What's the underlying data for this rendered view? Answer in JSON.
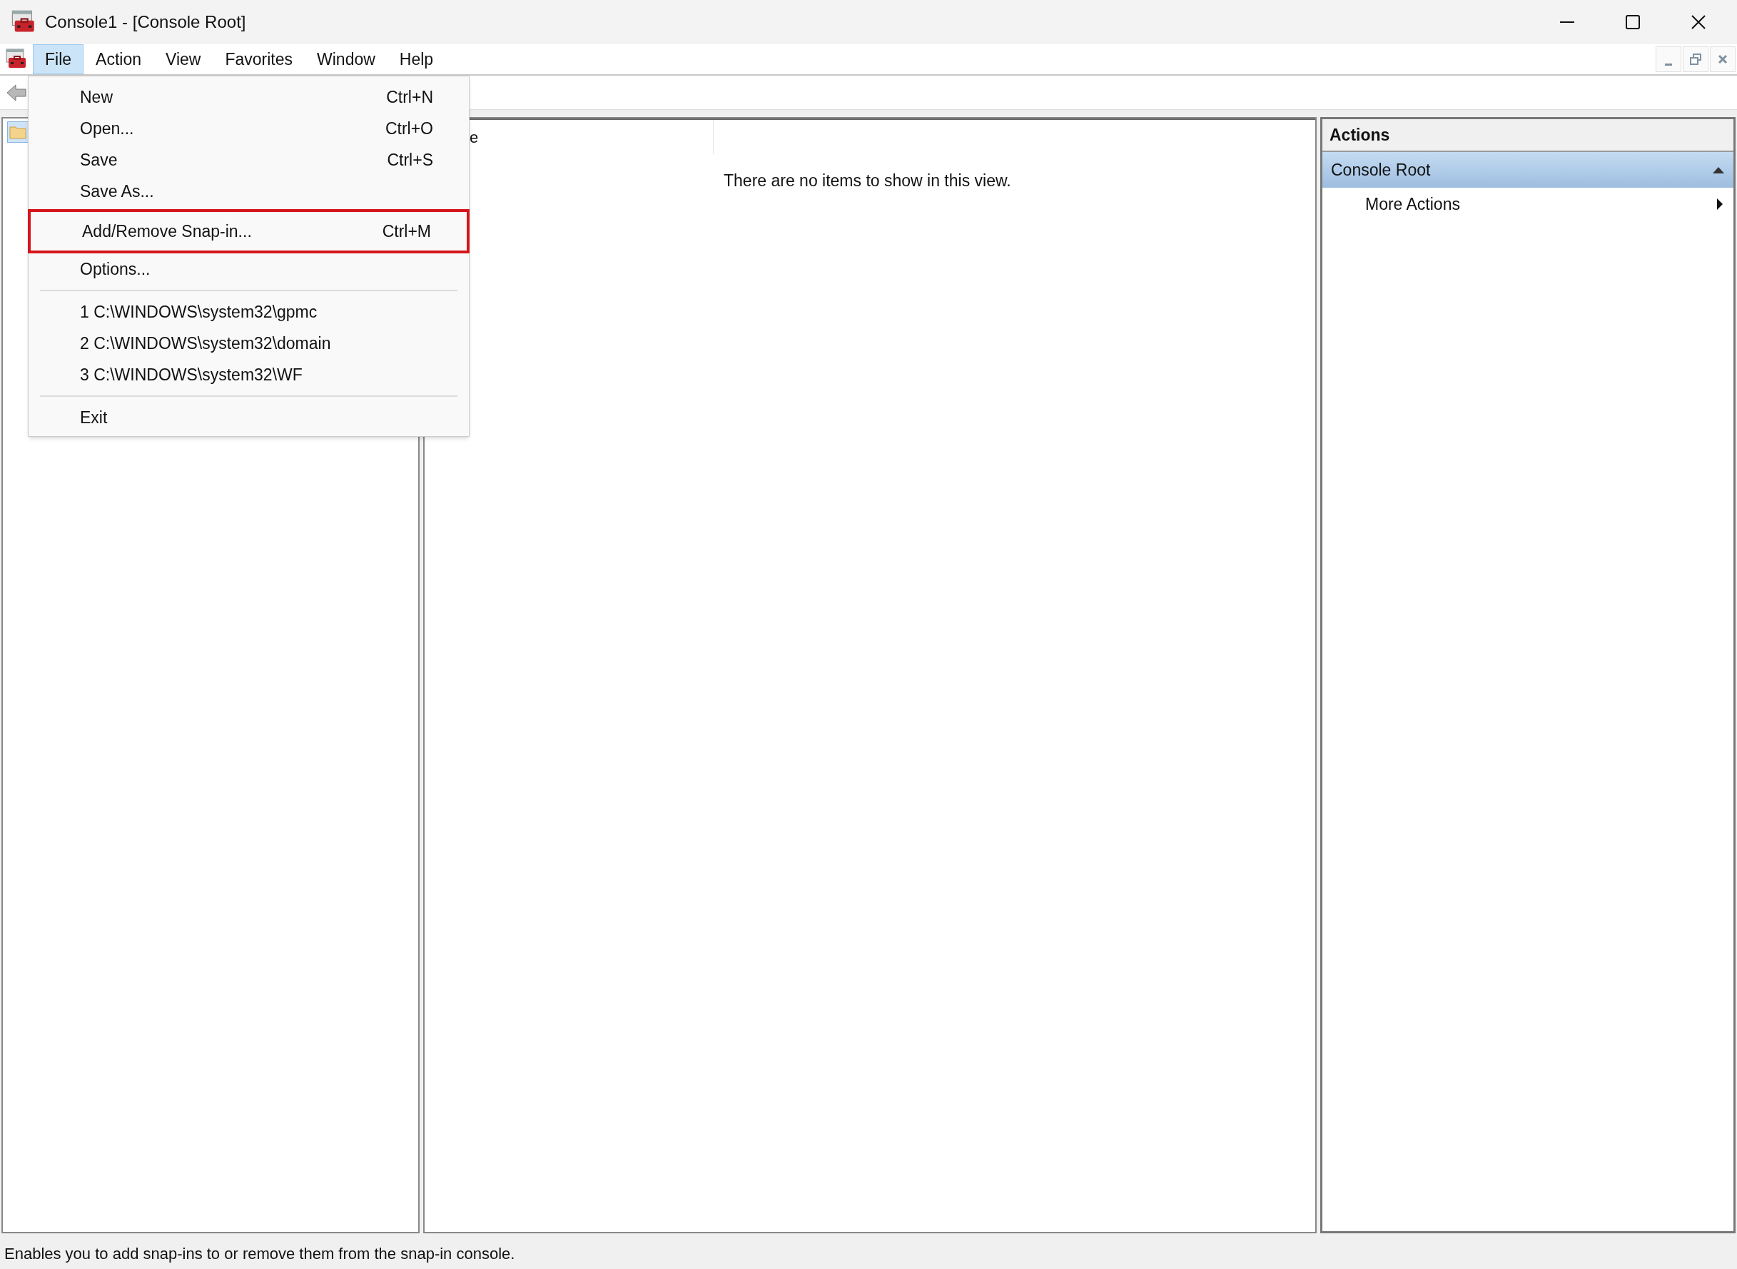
{
  "window": {
    "title": "Console1 - [Console Root]"
  },
  "menu_bar": [
    {
      "label": "File",
      "selected": true
    },
    {
      "label": "Action",
      "selected": false
    },
    {
      "label": "View",
      "selected": false
    },
    {
      "label": "Favorites",
      "selected": false
    },
    {
      "label": "Window",
      "selected": false
    },
    {
      "label": "Help",
      "selected": false
    }
  ],
  "file_menu": [
    {
      "kind": "item",
      "label": "New",
      "shortcut": "Ctrl+N",
      "highlighted": false
    },
    {
      "kind": "item",
      "label": "Open...",
      "shortcut": "Ctrl+O",
      "highlighted": false
    },
    {
      "kind": "item",
      "label": "Save",
      "shortcut": "Ctrl+S",
      "highlighted": false
    },
    {
      "kind": "item",
      "label": "Save As...",
      "highlighted": false
    },
    {
      "kind": "item",
      "label": "Add/Remove Snap-in...",
      "shortcut": "Ctrl+M",
      "highlighted": true
    },
    {
      "kind": "item",
      "label": "Options...",
      "highlighted": false
    },
    {
      "kind": "separator"
    },
    {
      "kind": "item",
      "label": "1 C:\\WINDOWS\\system32\\gpmc",
      "highlighted": false
    },
    {
      "kind": "item",
      "label": "2 C:\\WINDOWS\\system32\\domain",
      "highlighted": false
    },
    {
      "kind": "item",
      "label": "3 C:\\WINDOWS\\system32\\WF",
      "highlighted": false
    },
    {
      "kind": "separator"
    },
    {
      "kind": "item",
      "label": "Exit",
      "highlighted": false
    }
  ],
  "result_pane": {
    "columns": [
      {
        "label": "e"
      }
    ],
    "empty_message": "There are no items to show in this view."
  },
  "actions_pane": {
    "title": "Actions",
    "sections": [
      {
        "label": "Console Root",
        "expanded": true,
        "items": [
          {
            "label": "More Actions"
          }
        ]
      }
    ]
  },
  "status_bar": "Enables you to add snap-ins to or remove them from the snap-in console."
}
